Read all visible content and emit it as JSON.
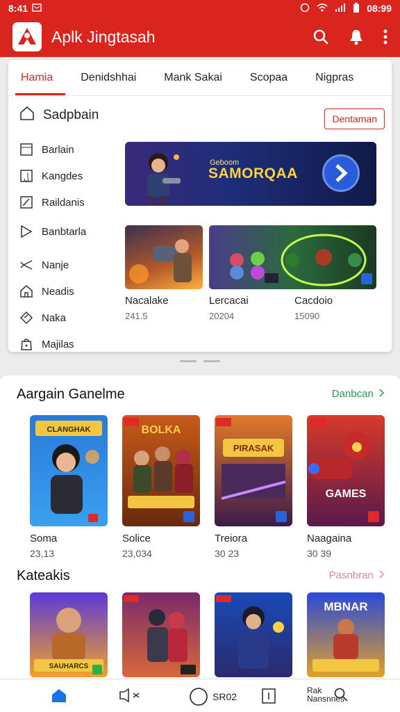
{
  "status": {
    "time": "8:41",
    "clock": "08:99"
  },
  "app": {
    "title": "Aplk Jingtasah"
  },
  "tabs": [
    {
      "label": "Hamia",
      "active": true
    },
    {
      "label": "Denidshhai"
    },
    {
      "label": "Mank Sakai"
    },
    {
      "label": "Scopaa"
    },
    {
      "label": "Nigpras"
    }
  ],
  "sidebar": {
    "title": "Sadpbain",
    "button": "Dentaman",
    "items": [
      {
        "label": "Barlain",
        "icon": "square-icon"
      },
      {
        "label": "Kangdes",
        "icon": "music-icon"
      },
      {
        "label": "Raildanis",
        "icon": "pen-icon"
      },
      {
        "label": "Banbtarla",
        "icon": "flag-icon"
      },
      {
        "label": "Nanje",
        "icon": "arrow-icon"
      },
      {
        "label": "Neadis",
        "icon": "house-icon"
      },
      {
        "label": "Naka",
        "icon": "clip-icon"
      },
      {
        "label": "Majilas",
        "icon": "bag-icon"
      }
    ]
  },
  "banner": {
    "small": "Geboom",
    "title": "SAMORQAA"
  },
  "featured": [
    {
      "name": "Nacalake",
      "count": "241.5"
    },
    {
      "name": "Lercacai",
      "count": "20204"
    },
    {
      "name": "Cacdoio",
      "count": "15090"
    }
  ],
  "section1": {
    "title": "Aargain Ganelme",
    "link": "Danbcan",
    "games": [
      {
        "name": "Soma",
        "count": "23,13"
      },
      {
        "name": "Solice",
        "count": "23,034"
      },
      {
        "name": "Treiora",
        "count": "30 23"
      },
      {
        "name": "Naagaina",
        "count": "30 39"
      }
    ],
    "art_titles": [
      "CLANGHAK",
      "BOLKA",
      "PIRASAK",
      "GAMES"
    ]
  },
  "section2": {
    "title": "Kateakis",
    "link": "Pasnbran",
    "art_titles": [
      "SAUHARCS",
      "",
      "",
      "MBNAR"
    ]
  },
  "bottomnav": {
    "play": "SR02",
    "search": "Rak Nansnnes"
  },
  "colors": {
    "accent": "#d9251d",
    "link_green": "#2b9a4a",
    "link_pink": "#e08a8a"
  }
}
